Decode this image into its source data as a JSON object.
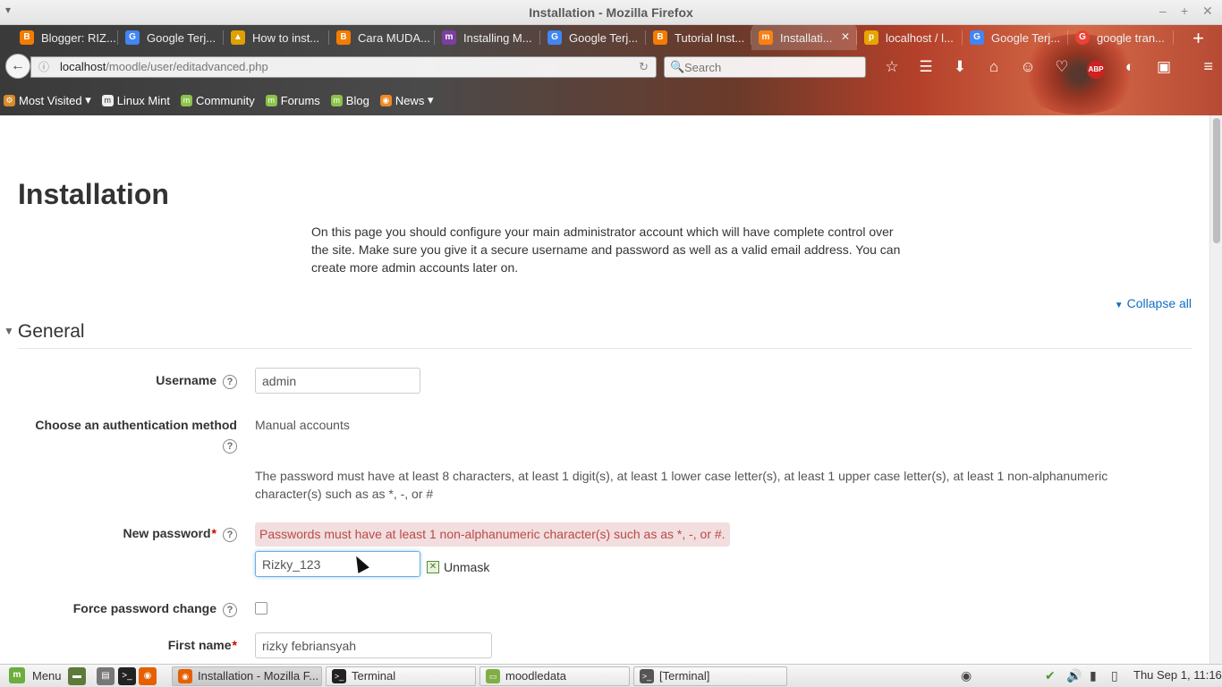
{
  "window": {
    "title": "Installation - Mozilla Firefox"
  },
  "tabs": [
    {
      "label": "Blogger: RIZ...",
      "icon": "blogger-icon",
      "color": "#f57c00"
    },
    {
      "label": "Google Terj...",
      "icon": "google-translate-icon",
      "color": "#4285f4"
    },
    {
      "label": "How to inst...",
      "icon": "linux-tux-icon",
      "color": "#e0a000"
    },
    {
      "label": "Cara MUDA...",
      "icon": "blogger-icon",
      "color": "#f57c00"
    },
    {
      "label": "Installing M...",
      "icon": "moodle-icon",
      "color": "#7b3fa0"
    },
    {
      "label": "Google Terj...",
      "icon": "google-translate-icon",
      "color": "#4285f4"
    },
    {
      "label": "Tutorial Inst...",
      "icon": "blogger-icon",
      "color": "#f57c00"
    },
    {
      "label": "Installati...",
      "icon": "moodle-icon",
      "color": "#f98012",
      "active": true
    },
    {
      "label": "localhost / l...",
      "icon": "phpmyadmin-icon",
      "color": "#e8a400"
    },
    {
      "label": "Google Terj...",
      "icon": "google-translate-icon",
      "color": "#4285f4"
    },
    {
      "label": "google tran...",
      "icon": "google-icon",
      "color": "#ea4335"
    }
  ],
  "navbar": {
    "url_host": "localhost",
    "url_path": "/moodle/user/editadvanced.php",
    "search_placeholder": "Search"
  },
  "bookmarks": [
    {
      "label": "Most Visited",
      "icon": "gear-icon",
      "dropdown": true
    },
    {
      "label": "Linux Mint",
      "icon": "linux-mint-icon"
    },
    {
      "label": "Community",
      "icon": "linux-mint-icon"
    },
    {
      "label": "Forums",
      "icon": "linux-mint-icon"
    },
    {
      "label": "Blog",
      "icon": "linux-mint-icon"
    },
    {
      "label": "News",
      "icon": "rss-icon",
      "dropdown": true
    }
  ],
  "page": {
    "heading": "Installation",
    "intro": "On this page you should configure your main administrator account which will have complete control over the site. Make sure you give it a secure username and password as well as a valid email address. You can create more admin accounts later on.",
    "collapse_all": "Collapse all",
    "section": "General",
    "username_label": "Username",
    "username_value": "admin",
    "auth_label": "Choose an authentication method",
    "auth_value": "Manual accounts",
    "password_rules": "The password must have at least 8 characters, at least 1 digit(s), at least 1 lower case letter(s), at least 1 upper case letter(s), at least 1 non-alphanumeric character(s) such as as *, -, or #",
    "new_password_label": "New password",
    "password_error": "Passwords must have at least 1 non-alphanumeric character(s) such as as *, -, or #.",
    "password_value": "Rizky_123",
    "unmask_label": "Unmask",
    "force_change_label": "Force password change",
    "first_name_label": "First name",
    "first_name_value": "rizky febriansyah"
  },
  "taskbar": {
    "menu_label": "Menu",
    "windows": [
      {
        "label": "Installation - Mozilla F...",
        "icon": "firefox-icon",
        "active": true
      },
      {
        "label": "Terminal",
        "icon": "terminal-icon"
      },
      {
        "label": "moodledata",
        "icon": "folder-icon"
      },
      {
        "label": "[Terminal]",
        "icon": "terminal-icon"
      }
    ],
    "clock": "Thu Sep  1, 11:16"
  },
  "colors": {
    "link": "#0f6fc5",
    "required": "#cc0000",
    "error_bg": "#f2dede",
    "error_text": "#b94a48"
  }
}
